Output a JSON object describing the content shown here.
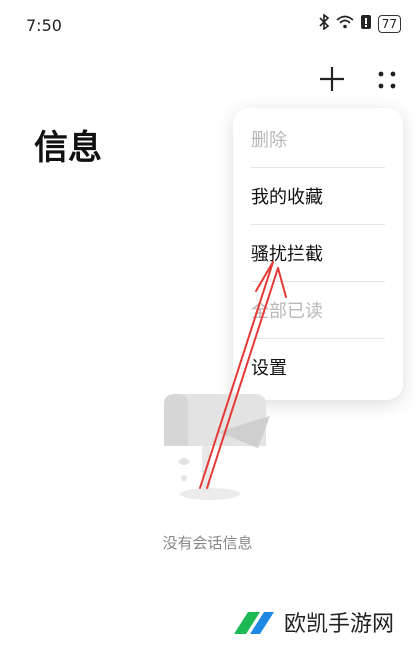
{
  "status_bar": {
    "time": "7:50",
    "battery": "77"
  },
  "header": {
    "title": "信息"
  },
  "menu": {
    "items": [
      {
        "label": "删除",
        "disabled": true
      },
      {
        "label": "我的收藏",
        "disabled": false
      },
      {
        "label": "骚扰拦截",
        "disabled": false
      },
      {
        "label": "全部已读",
        "disabled": true
      },
      {
        "label": "设置",
        "disabled": false
      }
    ]
  },
  "empty_state": {
    "text": "没有会话信息"
  },
  "watermark": {
    "text": "欧凯手游网"
  },
  "colors": {
    "annotation_arrow": "#e53935",
    "watermark_green": "#1db954",
    "watermark_blue": "#1e88e5"
  }
}
